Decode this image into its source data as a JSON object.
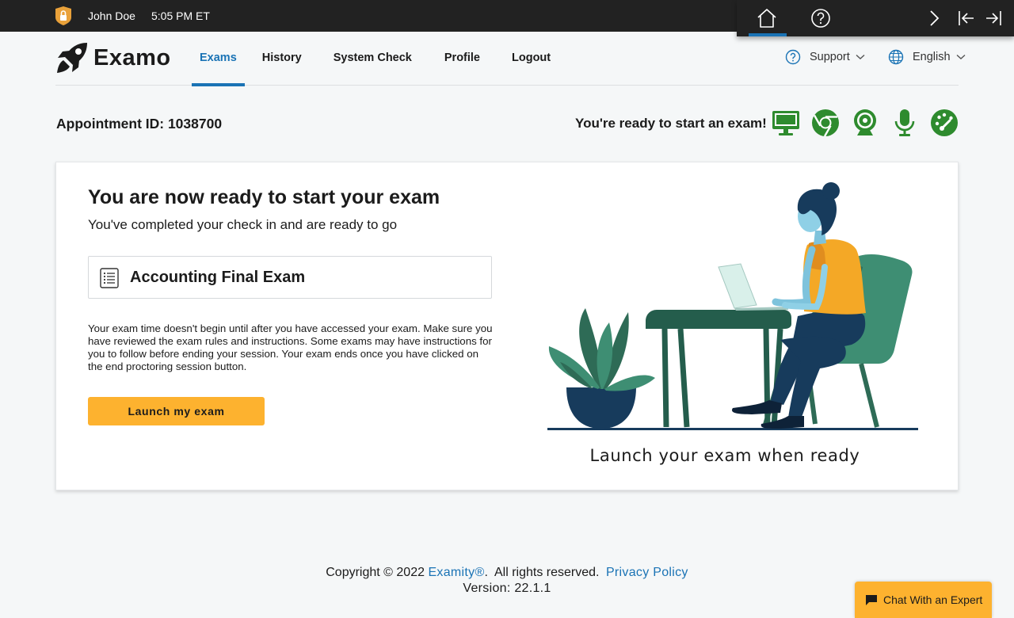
{
  "system_bar": {
    "user": "John Doe",
    "time": "5:05 PM ET"
  },
  "toolbar": {
    "icons": [
      "home-icon",
      "help-icon",
      "chevron-right-icon",
      "collapse-left-icon",
      "collapse-right-icon"
    ]
  },
  "header": {
    "brand": "Examo",
    "nav": [
      {
        "label": "Exams",
        "active": true
      },
      {
        "label": "History"
      },
      {
        "label": "System Check"
      },
      {
        "label": "Profile"
      },
      {
        "label": "Logout"
      }
    ],
    "support_label": "Support",
    "language_label": "English"
  },
  "appointment": {
    "label": "Appointment ID: 1038700",
    "ready_text": "You're ready to start an exam!",
    "status_icons": [
      "monitor-icon",
      "chrome-icon",
      "webcam-icon",
      "microphone-icon",
      "speed-gauge-icon"
    ]
  },
  "card": {
    "title": "You are now ready to start your exam",
    "subtitle": "You've completed your check in and are ready to go",
    "exam_name": "Accounting Final Exam",
    "description": "Your exam time doesn't begin until after you have accessed your exam. Make sure you have reviewed the exam rules and instructions. Some exams may have instructions for you to follow before ending your session. Your exam ends once you have clicked on the end proctoring session button.",
    "launch_button": "Launch my exam",
    "caption": "Launch your exam when ready"
  },
  "footer": {
    "copyright": "Copyright © 2022",
    "brand_link": "Examity®",
    "rights": ".  All rights reserved.",
    "privacy": "Privacy Policy",
    "version": "Version: 22.1.1"
  },
  "chat": {
    "label": "Chat With an Expert"
  },
  "colors": {
    "accent": "#1a73b5",
    "button": "#fdb22f",
    "status_green": "#2e8b2e",
    "dark_bar": "#222222"
  }
}
